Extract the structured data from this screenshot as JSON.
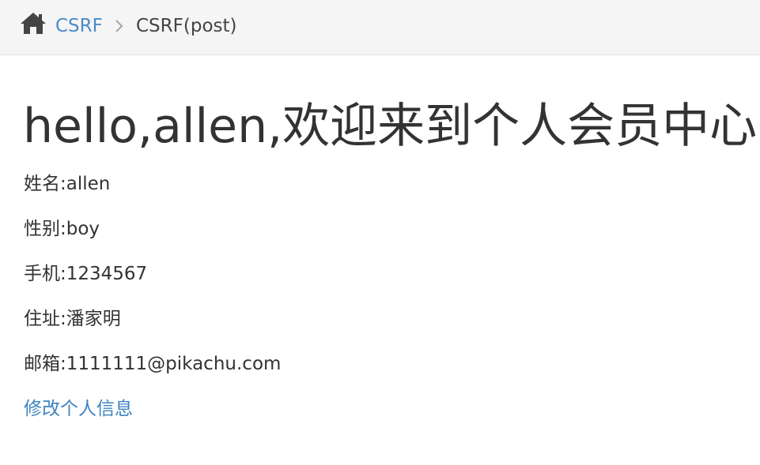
{
  "breadcrumb": {
    "home_icon": "home-icon",
    "link_label": "CSRF",
    "separator_icon": "chevron-right-icon",
    "current_label": "CSRF(post)"
  },
  "main": {
    "title": "hello,allen,欢迎来到个人会员中心",
    "fields": {
      "name": "姓名:allen",
      "sex": "性别:boy",
      "phone": "手机:1234567",
      "address": "住址:潘家明",
      "email": "邮箱:1111111@pikachu.com"
    },
    "edit_link_label": "修改个人信息"
  },
  "colors": {
    "breadcrumb_bg": "#f5f5f5",
    "link": "#4a8cc7",
    "text": "#333333"
  }
}
